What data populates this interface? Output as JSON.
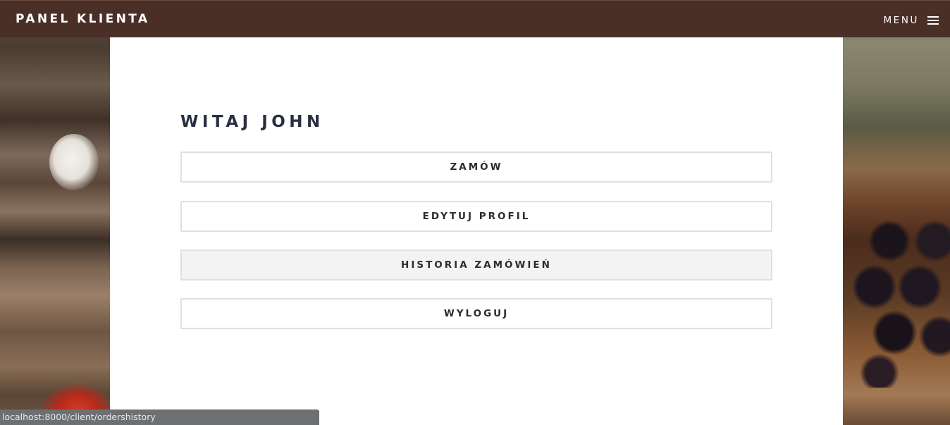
{
  "navbar": {
    "brand": "PANEL KLIENTA",
    "menu_label": "MENU",
    "menu_icon": "hamburger-icon",
    "background_color": "#4a2f27"
  },
  "main": {
    "title": "WITAJ JOHN",
    "buttons": [
      {
        "label": "ZAMÓW",
        "state": "normal"
      },
      {
        "label": "EDYTUJ PROFIL",
        "state": "normal"
      },
      {
        "label": "HISTORIA ZAMÓWIEŃ",
        "state": "hover"
      },
      {
        "label": "WYLOGUJ",
        "state": "normal"
      }
    ]
  },
  "statusbar": {
    "url": "localhost:8000/client/ordershistory"
  }
}
